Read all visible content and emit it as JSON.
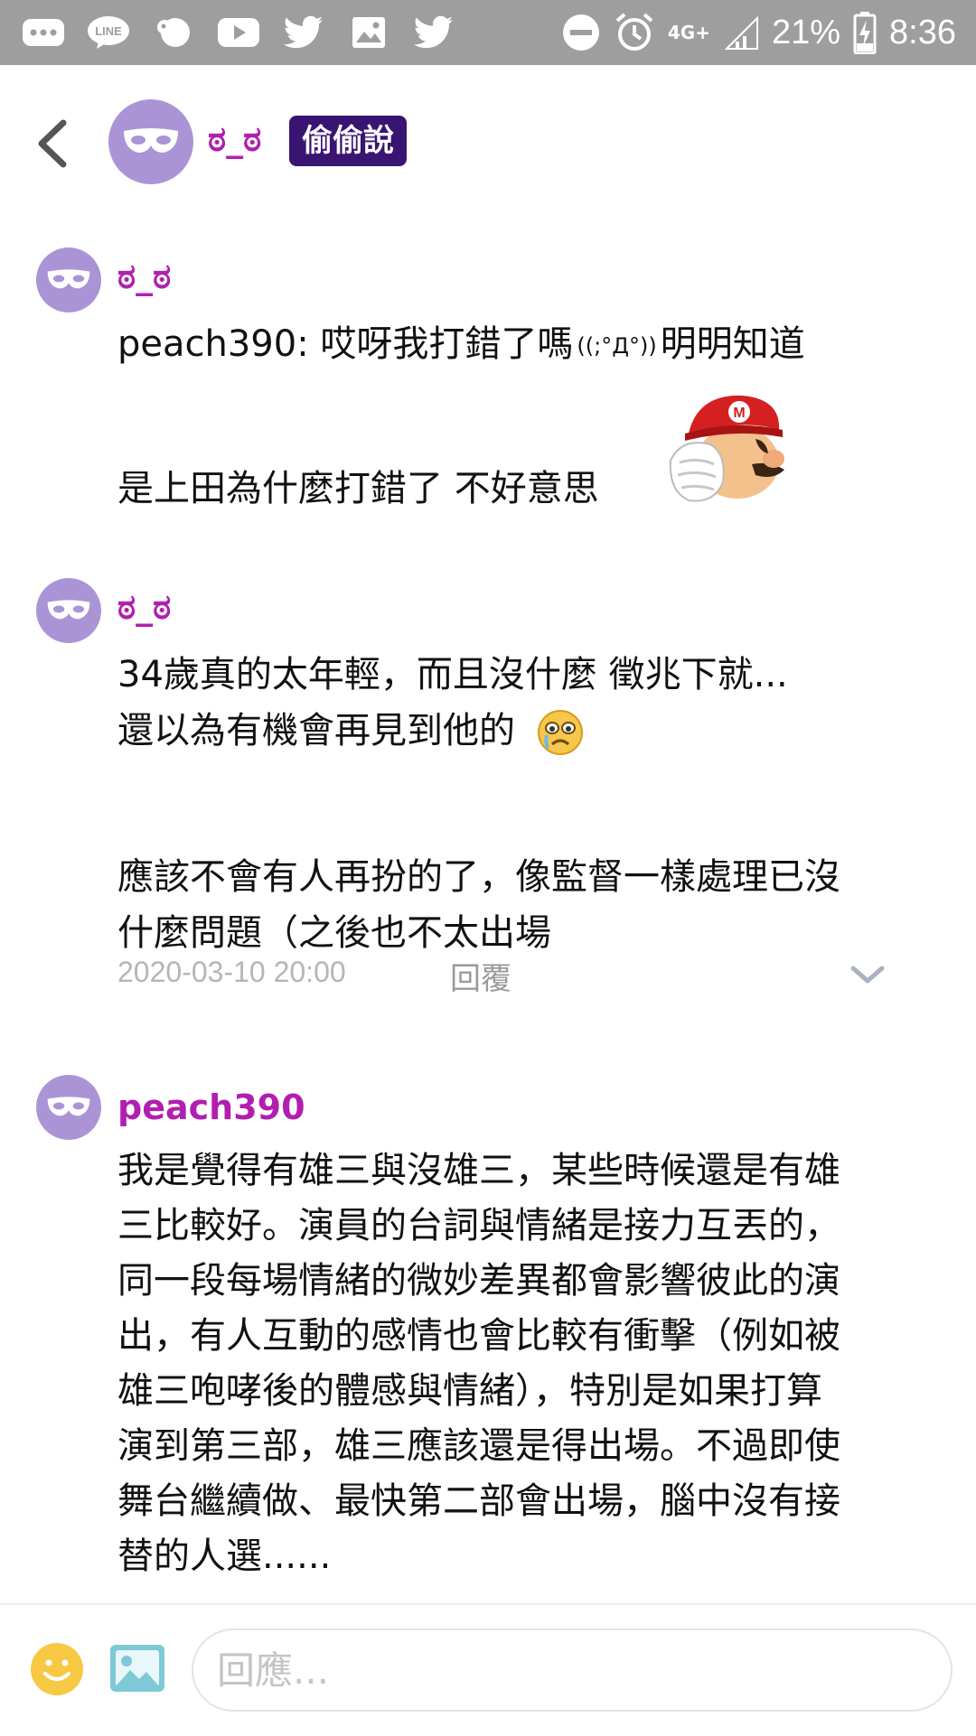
{
  "status_bar": {
    "network": "4G+",
    "battery": "21%",
    "time": "8:36"
  },
  "header": {
    "username": "ಠ_ಠ",
    "badge": "偷偷說"
  },
  "comments": [
    {
      "username": "ಠ_ಠ",
      "line1_a": "peach390: 哎呀我打錯了嗎",
      "kaomoji": "((;°Д°))",
      "line1_b": "明明知道",
      "line2": "是上田為什麼打錯了 不好意思",
      "sticker": "mario-facepalm-sticker"
    },
    {
      "username": "ಠ_ಠ",
      "lines": [
        "34歲真的太年輕，而且沒什麼 徵兆下就...",
        "還以為有機會再見到他的",
        "",
        "應該不會有人再扮的了，像監督一樣處理已沒",
        "什麼問題（之後也不太出場"
      ],
      "timestamp": "2020-03-10 20:00",
      "reply_label": "回覆"
    },
    {
      "username": "peach390",
      "lines": [
        "我是覺得有雄三與沒雄三，某些時候還是有雄",
        "三比較好。演員的台詞與情緒是接力互丟的，",
        "同一段每場情緒的微妙差異都會影響彼此的演",
        "出，有人互動的感情也會比較有衝擊（例如被",
        "雄三咆哮後的體感與情緒），特別是如果打算",
        "演到第三部，雄三應該還是得出場。不過即使",
        "舞台繼續做、最快第二部會出場，腦中沒有接",
        "替的人選......"
      ]
    }
  ],
  "reply_box": {
    "placeholder": "回應..."
  },
  "colors": {
    "status_bar": "#9e9e9e",
    "username": "#b01fb0",
    "badge_bg": "#3a1473",
    "avatar_bg": "#ab94d6"
  }
}
